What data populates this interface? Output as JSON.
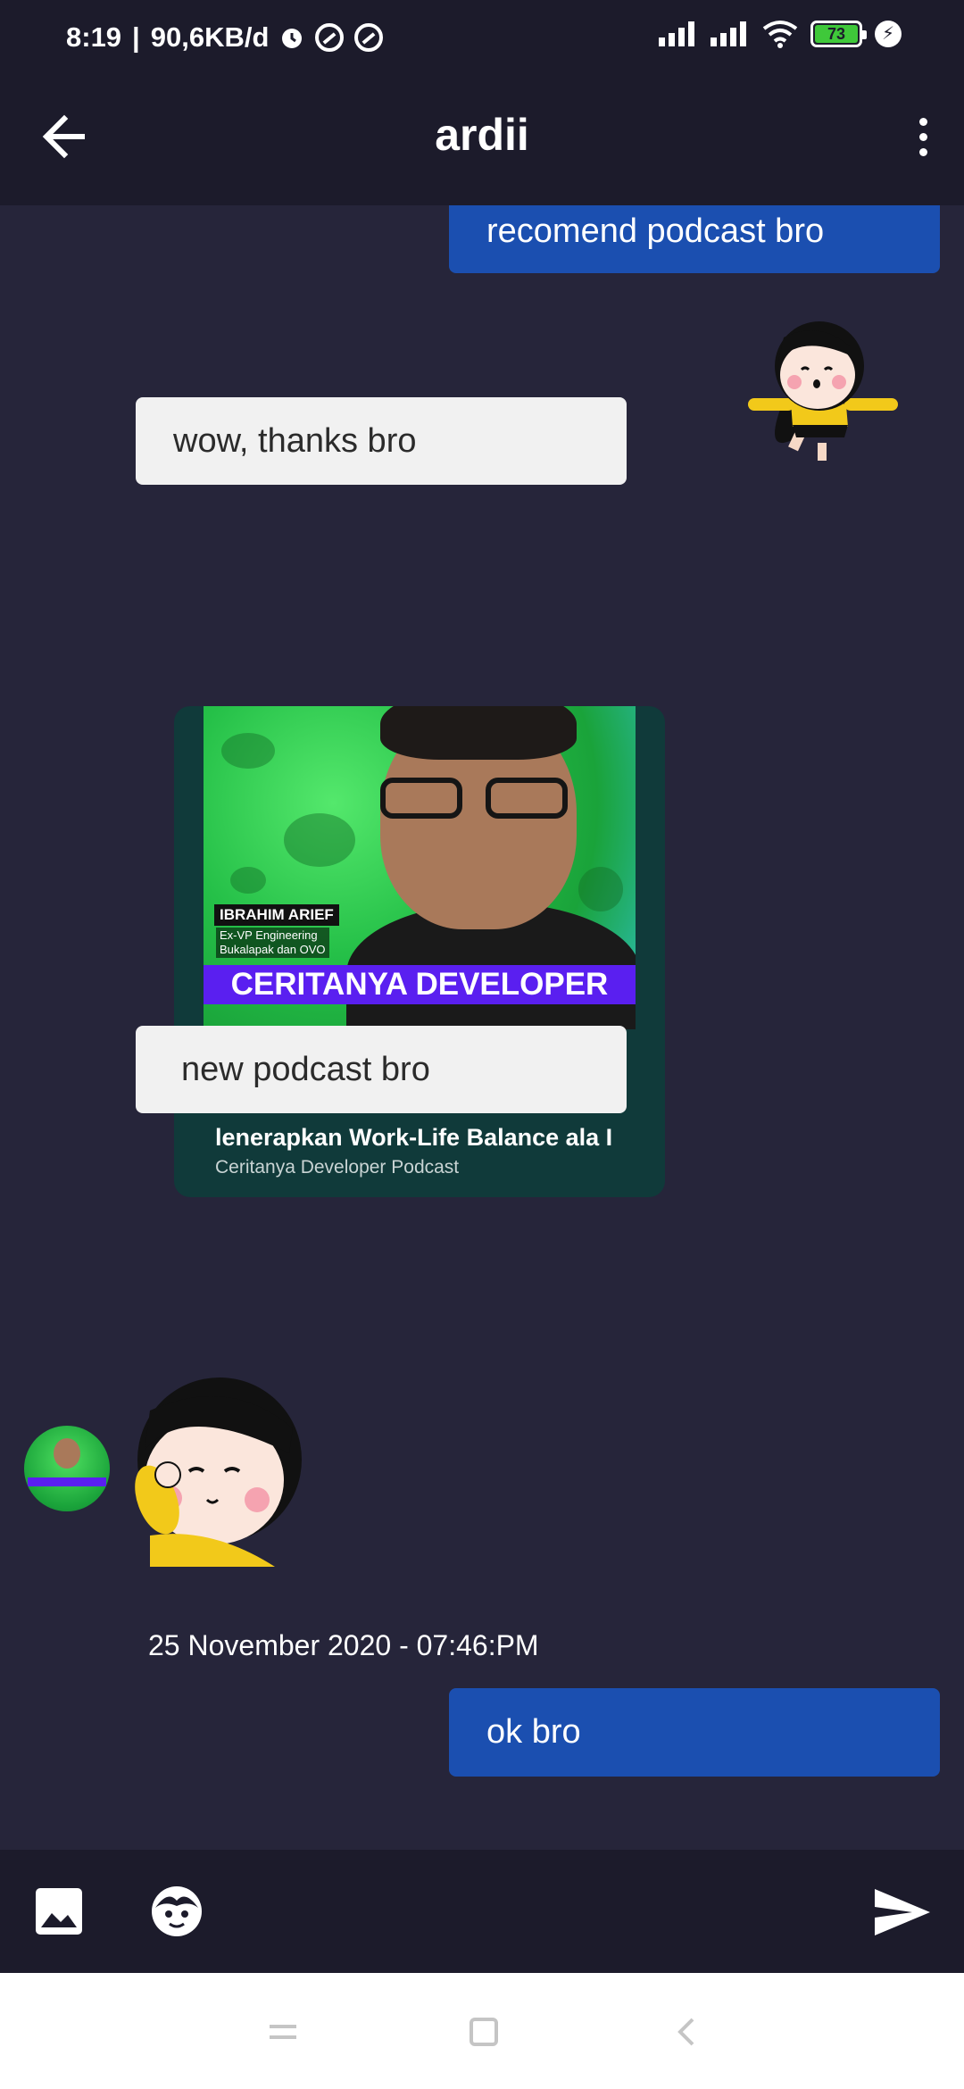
{
  "status_bar": {
    "time": "8:19",
    "network_speed": "90,6KB/d",
    "battery_level": "73",
    "icons": [
      "alarm-icon",
      "sync-icon",
      "sync-icon",
      "signal-icon",
      "signal-icon",
      "wifi-icon",
      "battery-icon",
      "charging-icon"
    ]
  },
  "header": {
    "title": "ardii",
    "back_icon": "arrow-left-icon",
    "menu_icon": "more-vertical-icon"
  },
  "messages": {
    "m1": "recomend podcast bro",
    "m2": "wow, thanks bro",
    "m3": "new podcast bro",
    "m4": "ok bro"
  },
  "podcast_card": {
    "guest_name": "IBRAHIM ARIEF",
    "guest_role_line1": "Ex-VP Engineering",
    "guest_role_line2": "Bukalapak dan OVO",
    "show_banner": "CERITANYA DEVELOPER",
    "episode_title": "lenerapkan Work-Life Balance ala I",
    "show_name": "Ceritanya Developer Podcast"
  },
  "timestamp": "25 November 2020 - 07:46:PM",
  "input_bar": {
    "icons": [
      "image-icon",
      "sticker-icon",
      "send-icon"
    ]
  },
  "nav_bar": {
    "icons": [
      "menu-icon",
      "home-icon",
      "back-icon"
    ]
  },
  "colors": {
    "background": "#26253a",
    "bar": "#1c1b2b",
    "outgoing_bubble": "#1b4fb0",
    "incoming_bubble": "#f1f1f1"
  }
}
